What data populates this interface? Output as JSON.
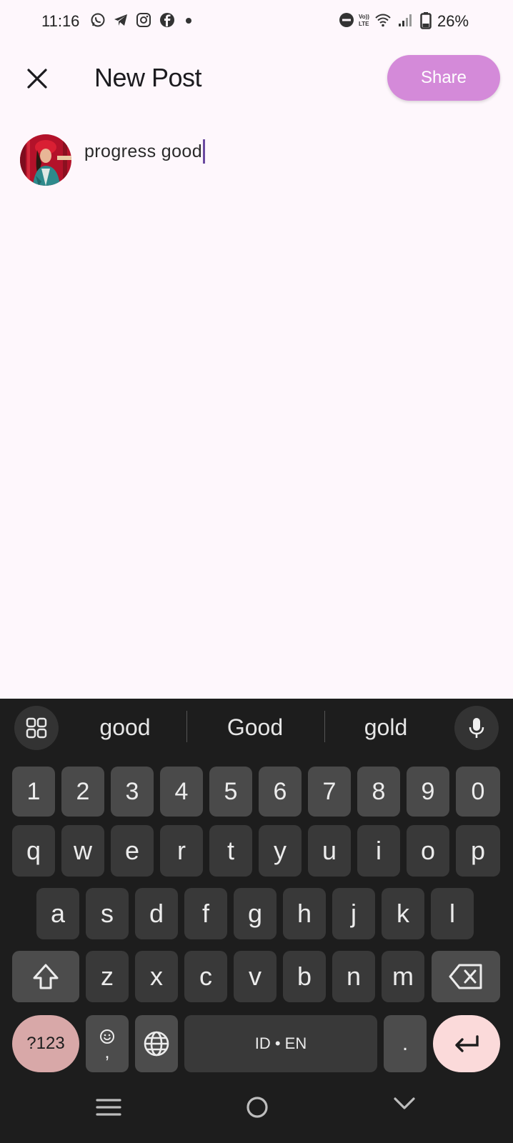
{
  "status_bar": {
    "time": "11:16",
    "battery": "26%",
    "icons": [
      "whatsapp-icon",
      "telegram-icon",
      "instagram-icon",
      "facebook-icon",
      "dot-icon",
      "do-not-disturb-icon",
      "volte-icon",
      "wifi-icon",
      "signal-icon",
      "battery-icon"
    ]
  },
  "header": {
    "title": "New Post",
    "share_label": "Share"
  },
  "post": {
    "text": "progress good"
  },
  "keyboard": {
    "suggestions": [
      "good",
      "Good",
      "gold"
    ],
    "row_numbers": [
      "1",
      "2",
      "3",
      "4",
      "5",
      "6",
      "7",
      "8",
      "9",
      "0"
    ],
    "row_top": [
      "q",
      "w",
      "e",
      "r",
      "t",
      "y",
      "u",
      "i",
      "o",
      "p"
    ],
    "row_mid": [
      "a",
      "s",
      "d",
      "f",
      "g",
      "h",
      "j",
      "k",
      "l"
    ],
    "row_bottom": [
      "z",
      "x",
      "c",
      "v",
      "b",
      "n",
      "m"
    ],
    "symbols_label": "?123",
    "comma_label": ",",
    "space_label": "ID • EN",
    "period_label": "."
  },
  "colors": {
    "accent": "#d48ad9",
    "caret": "#6b4aa0",
    "enter_key": "#fbdada",
    "symbols_key": "#d8a8a8"
  }
}
